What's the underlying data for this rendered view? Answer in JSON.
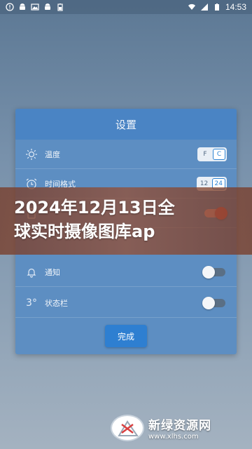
{
  "statusbar": {
    "time": "14:53",
    "left_icons": [
      "alert-icon",
      "android-icon",
      "picture-icon",
      "android-icon",
      "battery-icon"
    ],
    "right_icons": [
      "wifi-icon",
      "signal-icon",
      "battery-icon"
    ]
  },
  "dialog": {
    "title": "设置",
    "rows": [
      {
        "label": "温度",
        "icon": "sun-icon",
        "control": "segmented",
        "options": [
          "F",
          "C"
        ],
        "selected": "C"
      },
      {
        "label": "时间格式",
        "icon": "alarm-icon",
        "control": "segmented",
        "options": [
          "12",
          "24"
        ],
        "selected": "24"
      },
      {
        "label": "",
        "icon": "lock-icon",
        "control": "toggle",
        "on": true
      },
      {
        "label": "通知",
        "icon": "bell-icon",
        "control": "toggle",
        "on": false
      },
      {
        "label": "状态栏",
        "icon": "degree-icon",
        "icon_text": "3°",
        "control": "toggle",
        "on": false
      }
    ],
    "done_label": "完成"
  },
  "banner": {
    "text": "2024年12月13日全\n球实时摄像图库ap"
  },
  "watermark": {
    "name": "新绿资源网",
    "url": "www.xlhs.com"
  },
  "colors": {
    "dialog_bg": "#5d8ec2",
    "dialog_header": "#4a84c4",
    "accent": "#2e84d4",
    "toggle_on": "#e65a5a",
    "banner": "#96503a"
  }
}
